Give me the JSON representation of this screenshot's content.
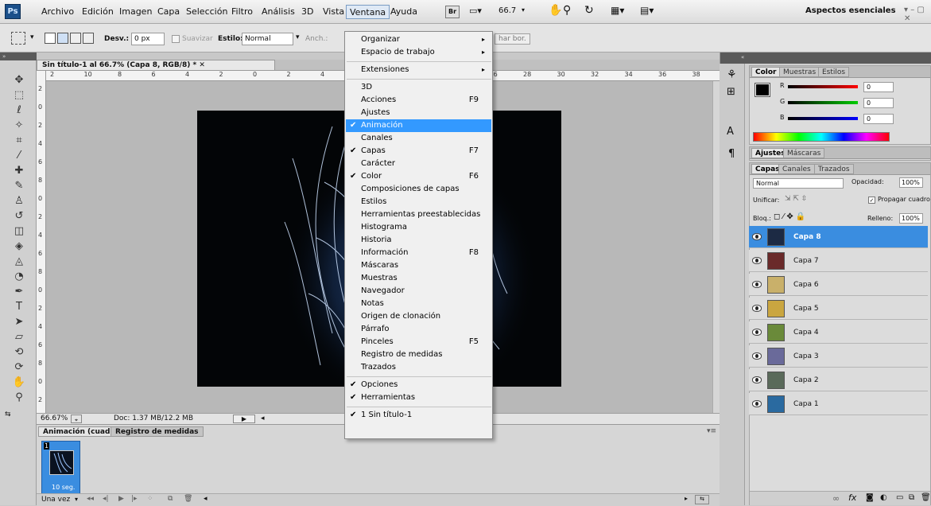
{
  "app_logo": "Ps",
  "menubar": {
    "items": [
      "Archivo",
      "Edición",
      "Imagen",
      "Capa",
      "Selección",
      "Filtro",
      "Análisis",
      "3D",
      "Vista",
      "Ventana",
      "Ayuda"
    ],
    "bridge": "Br",
    "zoom": "66.7",
    "workspace": "Aspectos esenciales"
  },
  "options": {
    "desv_label": "Desv.:",
    "desv_value": "0 px",
    "suavizar": "Suavizar",
    "estilo_label": "Estilo:",
    "estilo_value": "Normal",
    "anch": "Anch.:",
    "refine": "har bor."
  },
  "document": {
    "tab": "Sin título-1 al 66.7% (Capa 8, RGB/8) *",
    "ruler_h": [
      "2",
      "10",
      "8",
      "6",
      "4",
      "2",
      "0",
      "2",
      "4",
      "6",
      "8",
      "10",
      "24",
      "26",
      "28",
      "30",
      "32",
      "34",
      "36",
      "38"
    ],
    "ruler_v": [
      "2",
      "0",
      "2",
      "4",
      "6",
      "8",
      "0",
      "2",
      "4",
      "6",
      "8",
      "0",
      "2",
      "4",
      "6",
      "8",
      "0",
      "2"
    ]
  },
  "status": {
    "zoom": "66.67%",
    "doc": "Doc: 1.37 MB/12.2 MB"
  },
  "animation": {
    "tab1": "Animación (cuadros)",
    "tab2": "Registro de medidas",
    "frame_num": "1",
    "frame_time": "10 seg.",
    "loop": "Una vez"
  },
  "ventana_menu": {
    "items": [
      {
        "label": "Organizar",
        "arrow": "▸"
      },
      {
        "label": "Espacio de trabajo",
        "arrow": "▸"
      },
      {
        "sep": true
      },
      {
        "label": "Extensiones",
        "arrow": "▸"
      },
      {
        "sep": true
      },
      {
        "label": "3D"
      },
      {
        "label": "Acciones",
        "shortcut": "F9"
      },
      {
        "label": "Ajustes"
      },
      {
        "label": "Animación",
        "checked": true,
        "highlight": true
      },
      {
        "label": "Canales"
      },
      {
        "label": "Capas",
        "shortcut": "F7",
        "checked": true
      },
      {
        "label": "Carácter"
      },
      {
        "label": "Color",
        "shortcut": "F6",
        "checked": true
      },
      {
        "label": "Composiciones de capas"
      },
      {
        "label": "Estilos"
      },
      {
        "label": "Herramientas preestablecidas"
      },
      {
        "label": "Histograma"
      },
      {
        "label": "Historia"
      },
      {
        "label": "Información",
        "shortcut": "F8"
      },
      {
        "label": "Máscaras"
      },
      {
        "label": "Muestras"
      },
      {
        "label": "Navegador"
      },
      {
        "label": "Notas"
      },
      {
        "label": "Origen de clonación"
      },
      {
        "label": "Párrafo"
      },
      {
        "label": "Pinceles",
        "shortcut": "F5"
      },
      {
        "label": "Registro de medidas"
      },
      {
        "label": "Trazados"
      },
      {
        "sep": true
      },
      {
        "label": "Opciones",
        "checked": true
      },
      {
        "label": "Herramientas",
        "checked": true
      },
      {
        "sep": true
      },
      {
        "label": "1 Sin título-1",
        "checked": true
      }
    ]
  },
  "color_panel": {
    "tabs": [
      "Color",
      "Muestras",
      "Estilos"
    ],
    "r": "R",
    "g": "G",
    "b": "B",
    "r_val": "0",
    "g_val": "0",
    "b_val": "0",
    "fg_color": "#000000"
  },
  "ajustes_panel": {
    "tabs": [
      "Ajustes",
      "Máscaras"
    ]
  },
  "layers_panel": {
    "tabs": [
      "Capas",
      "Canales",
      "Trazados"
    ],
    "blend": "Normal",
    "opacity_label": "Opacidad:",
    "opacity": "100%",
    "unify": "Unificar:",
    "propagate": "Propagar cuadro",
    "lock": "Bloq.:",
    "fill_label": "Relleno:",
    "fill": "100%",
    "layers": [
      {
        "name": "Capa 8",
        "selected": true,
        "thumb": "#1c2a44"
      },
      {
        "name": "Capa 7",
        "thumb": "#6a2a2a"
      },
      {
        "name": "Capa 6",
        "thumb": "#c9b06a"
      },
      {
        "name": "Capa 5",
        "thumb": "#caa640"
      },
      {
        "name": "Capa 4",
        "thumb": "#6a8a3a"
      },
      {
        "name": "Capa 3",
        "thumb": "#6a6a9a"
      },
      {
        "name": "Capa 2",
        "thumb": "#5a6a5a"
      },
      {
        "name": "Capa 1",
        "thumb": "#2a6aa0"
      }
    ]
  }
}
